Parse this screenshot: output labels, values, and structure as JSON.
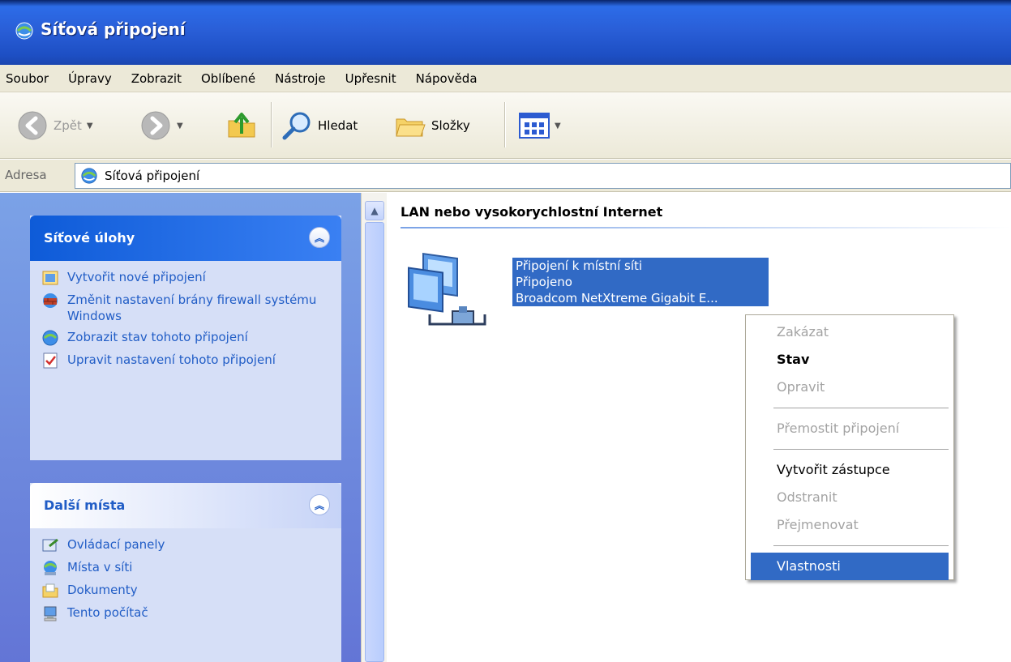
{
  "window": {
    "title": "Síťová připojení",
    "icon": "network-connections-icon"
  },
  "menu": [
    "Soubor",
    "Úpravy",
    "Zobrazit",
    "Oblíbené",
    "Nástroje",
    "Upřesnit",
    "Nápověda"
  ],
  "toolbar": {
    "back_label": "Zpět",
    "search_label": "Hledat",
    "folders_label": "Složky"
  },
  "address": {
    "label": "Adresa",
    "value": "Síťová připojení"
  },
  "left_pane": {
    "network_tasks": {
      "title": "Síťové úlohy",
      "items": [
        {
          "label": "Vytvořit nové připojení",
          "icon": "new-connection-icon"
        },
        {
          "label": "Změnit nastavení brány firewall systému Windows",
          "icon": "firewall-icon"
        },
        {
          "label": "Zobrazit stav tohoto připojení",
          "icon": "status-icon"
        },
        {
          "label": "Upravit nastavení tohoto připojení",
          "icon": "properties-icon"
        }
      ]
    },
    "other_places": {
      "title": "Další místa",
      "items": [
        {
          "label": "Ovládací panely",
          "icon": "control-panel-icon"
        },
        {
          "label": "Místa v síti",
          "icon": "network-places-icon"
        },
        {
          "label": "Dokumenty",
          "icon": "documents-icon"
        },
        {
          "label": "Tento počítač",
          "icon": "my-computer-icon"
        }
      ]
    }
  },
  "content": {
    "group_title": "LAN nebo vysokorychlostní Internet",
    "connection": {
      "name": "Připojení k místní síti",
      "status": "Připojeno",
      "device": "Broadcom NetXtreme Gigabit E..."
    }
  },
  "context_menu": {
    "items": [
      {
        "label": "Zakázat",
        "state": "disabled"
      },
      {
        "label": "Stav",
        "state": "default"
      },
      {
        "label": "Opravit",
        "state": "disabled"
      },
      {
        "label": "Přemostit připojení",
        "state": "disabled"
      },
      {
        "label": "Vytvořit zástupce",
        "state": "enabled"
      },
      {
        "label": "Odstranit",
        "state": "disabled"
      },
      {
        "label": "Přejmenovat",
        "state": "disabled"
      },
      {
        "label": "Vlastnosti",
        "state": "highlighted"
      }
    ]
  },
  "colors": {
    "title_bar": "#2a5fd8",
    "selection": "#316ac5",
    "task_link": "#215dc6",
    "left_pane": "#7ba2e7"
  }
}
